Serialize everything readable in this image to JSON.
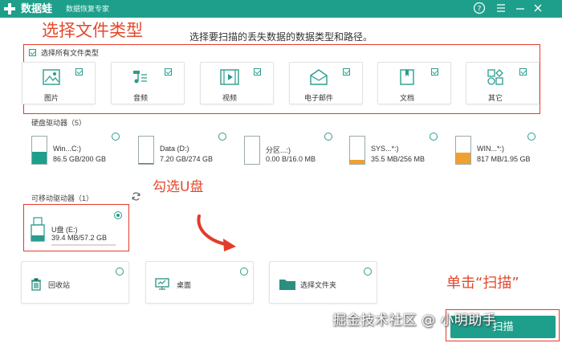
{
  "app": {
    "name": "数据蛙",
    "subtitle": "数据恢复专家"
  },
  "titlebar": {
    "help_icon": "question-icon",
    "menu_icon": "menu-icon",
    "minimize_icon": "minimize-icon",
    "close_icon": "close-icon"
  },
  "annotations": {
    "select_file_types": "选择文件类型",
    "check_usb": "勾选U盘",
    "click_scan": "单击“扫描”"
  },
  "instruction": "选择要扫描的丢失数据的数据类型和路径。",
  "file_types": {
    "select_all_label": "选择所有文件类型",
    "items": [
      {
        "label": "图片",
        "icon": "image-icon",
        "checked": true
      },
      {
        "label": "音频",
        "icon": "music-icon",
        "checked": true
      },
      {
        "label": "视频",
        "icon": "video-icon",
        "checked": true
      },
      {
        "label": "电子邮件",
        "icon": "email-icon",
        "checked": true
      },
      {
        "label": "文档",
        "icon": "document-icon",
        "checked": true
      },
      {
        "label": "其它",
        "icon": "other-icon",
        "checked": true
      }
    ]
  },
  "hard_drives": {
    "title": "硬盘驱动器（5）",
    "items": [
      {
        "name": "Win...C:)",
        "size": "86.5 GB/200 GB",
        "used_fraction": 0.43,
        "color": "#1e9f8b"
      },
      {
        "name": "Data (D:)",
        "size": "7.20 GB/274 GB",
        "used_fraction": 0.03,
        "color": "#1e9f8b"
      },
      {
        "name": "分区...:)",
        "size": "0.00  B/16.0 MB",
        "used_fraction": 0.0,
        "color": "#f0a030"
      },
      {
        "name": "SYS...*:)",
        "size": "35.5 MB/256 MB",
        "used_fraction": 0.14,
        "color": "#f0a030"
      },
      {
        "name": "WIN...*:)",
        "size": "817 MB/1.95 GB",
        "used_fraction": 0.42,
        "color": "#f0a030"
      }
    ]
  },
  "removable_drives": {
    "title": "可移动驱动器（1）",
    "refresh_icon": "refresh-icon",
    "items": [
      {
        "name": "U盘 (E:)",
        "size": "39.4 MB/57.2 GB",
        "selected": true
      }
    ]
  },
  "locations": [
    {
      "label": "回收站",
      "icon": "recycle-bin-icon"
    },
    {
      "label": "桌面",
      "icon": "desktop-icon"
    },
    {
      "label": "选择文件夹",
      "icon": "folder-icon"
    }
  ],
  "scan_button": "扫描",
  "watermark": "掘金技术社区 @ 小明助手",
  "colors": {
    "accent": "#1e9f8b",
    "annotation": "#e4482c"
  }
}
